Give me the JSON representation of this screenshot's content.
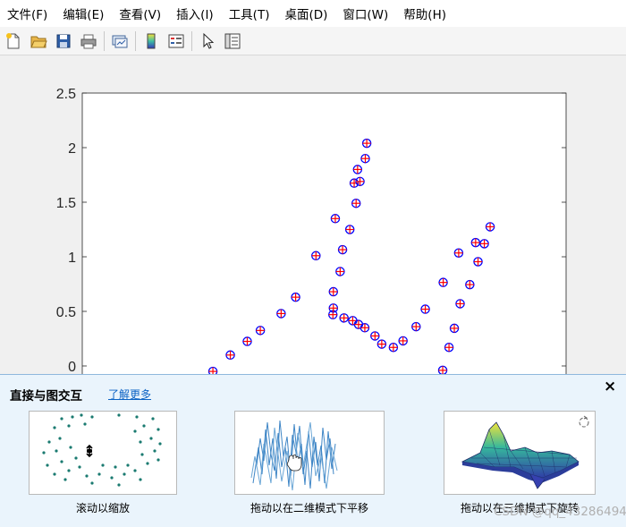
{
  "menu": {
    "items": [
      "文件(F)",
      "编辑(E)",
      "查看(V)",
      "插入(I)",
      "工具(T)",
      "桌面(D)",
      "窗口(W)",
      "帮助(H)"
    ]
  },
  "toolbar": {
    "buttons": [
      "new-figure-icon",
      "open-file-icon",
      "save-icon",
      "print-icon",
      "link-plot-icon",
      "insert-colorbar-icon",
      "insert-legend-icon",
      "edit-plot-pointer-icon",
      "property-inspector-icon"
    ]
  },
  "chart_data": {
    "type": "scatter",
    "marker": "blue circle with red plus",
    "colors": {
      "circle": "#0000ff",
      "plus": "#ff0000",
      "axes_bg": "#ffffff",
      "figure_bg": "#f0f0f0"
    },
    "ylim": [
      0,
      2.5
    ],
    "yticks": [
      "0",
      "0.5",
      "1",
      "1.5",
      "2",
      "2.5"
    ],
    "xlim": [
      0,
      1
    ],
    "points": [
      {
        "x": 0.27,
        "y": -0.05
      },
      {
        "x": 0.306,
        "y": 0.1
      },
      {
        "x": 0.341,
        "y": 0.225
      },
      {
        "x": 0.368,
        "y": 0.325
      },
      {
        "x": 0.411,
        "y": 0.48
      },
      {
        "x": 0.441,
        "y": 0.63
      },
      {
        "x": 0.483,
        "y": 1.01
      },
      {
        "x": 0.518,
        "y": 0.47
      },
      {
        "x": 0.519,
        "y": 0.53
      },
      {
        "x": 0.519,
        "y": 0.68
      },
      {
        "x": 0.523,
        "y": 1.35
      },
      {
        "x": 0.533,
        "y": 0.865
      },
      {
        "x": 0.538,
        "y": 1.065
      },
      {
        "x": 0.541,
        "y": 0.44
      },
      {
        "x": 0.553,
        "y": 1.25
      },
      {
        "x": 0.559,
        "y": 0.415
      },
      {
        "x": 0.562,
        "y": 1.675
      },
      {
        "x": 0.566,
        "y": 1.49
      },
      {
        "x": 0.569,
        "y": 1.8
      },
      {
        "x": 0.571,
        "y": 0.38
      },
      {
        "x": 0.574,
        "y": 1.69
      },
      {
        "x": 0.584,
        "y": 0.35
      },
      {
        "x": 0.585,
        "y": 1.9
      },
      {
        "x": 0.588,
        "y": 2.04
      },
      {
        "x": 0.605,
        "y": 0.275
      },
      {
        "x": 0.619,
        "y": 0.2
      },
      {
        "x": 0.643,
        "y": 0.17
      },
      {
        "x": 0.663,
        "y": 0.23
      },
      {
        "x": 0.69,
        "y": 0.36
      },
      {
        "x": 0.709,
        "y": 0.52
      },
      {
        "x": 0.745,
        "y": -0.04
      },
      {
        "x": 0.746,
        "y": 0.765
      },
      {
        "x": 0.758,
        "y": 0.17
      },
      {
        "x": 0.769,
        "y": 0.345
      },
      {
        "x": 0.778,
        "y": 1.035
      },
      {
        "x": 0.781,
        "y": 0.57
      },
      {
        "x": 0.801,
        "y": 0.745
      },
      {
        "x": 0.813,
        "y": 1.13
      },
      {
        "x": 0.818,
        "y": 0.955
      },
      {
        "x": 0.831,
        "y": 1.12
      },
      {
        "x": 0.843,
        "y": 1.275
      }
    ]
  },
  "banner": {
    "title": "直接与图交互",
    "link": "了解更多",
    "close": "×",
    "cards": [
      {
        "label": "滚动以缩放"
      },
      {
        "label": "拖动以在二维模式下平移"
      },
      {
        "label": "拖动以在三维模式下旋转"
      }
    ]
  },
  "watermark": "CSDN @qq_43286494"
}
